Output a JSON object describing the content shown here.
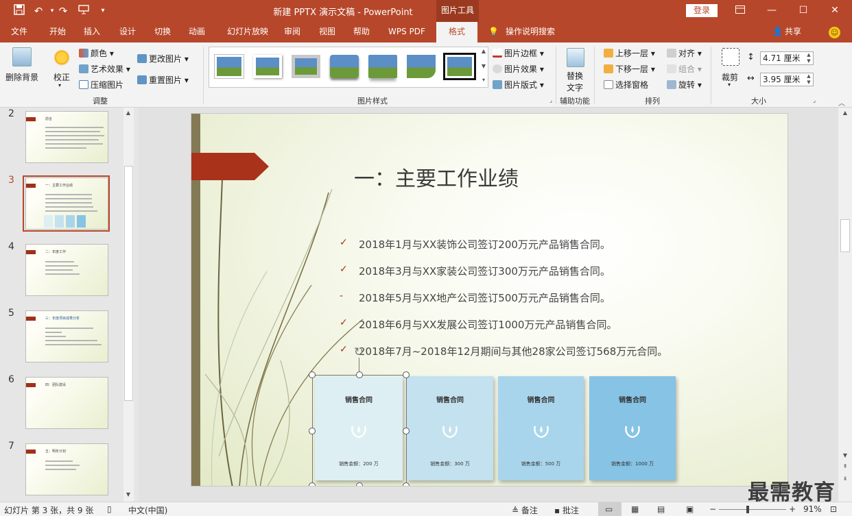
{
  "titlebar": {
    "title": "新建 PPTX 演示文稿  -  PowerPoint",
    "tool_tab": "图片工具",
    "login": "登录",
    "qat_icons": [
      "save-icon",
      "undo-icon",
      "redo-icon",
      "present-icon",
      "customize-icon"
    ]
  },
  "tabs": [
    {
      "label": "文件"
    },
    {
      "label": "开始"
    },
    {
      "label": "插入"
    },
    {
      "label": "设计"
    },
    {
      "label": "切换"
    },
    {
      "label": "动画"
    },
    {
      "label": "幻灯片放映"
    },
    {
      "label": "审阅"
    },
    {
      "label": "视图"
    },
    {
      "label": "帮助"
    },
    {
      "label": "WPS PDF"
    },
    {
      "label": "格式"
    }
  ],
  "tell_me": "操作说明搜索",
  "share": "共享",
  "ribbon": {
    "adjust": {
      "remove_bg": "删除背景",
      "correct": "校正",
      "color": "颜色",
      "artistic": "艺术效果",
      "compress": "压缩图片",
      "change": "更改图片",
      "reset": "重置图片",
      "group_label": "调整"
    },
    "styles": {
      "border": "图片边框",
      "effects": "图片效果",
      "layout": "图片版式",
      "group_label": "图片样式"
    },
    "accessibility": {
      "alt_text_1": "替换",
      "alt_text_2": "文字",
      "group_label": "辅助功能"
    },
    "arrange": {
      "bring_forward": "上移一层",
      "send_backward": "下移一层",
      "selection_pane": "选择窗格",
      "align": "对齐",
      "group": "组合",
      "rotate": "旋转",
      "group_label": "排列"
    },
    "size": {
      "crop": "裁剪",
      "height": "4.71 厘米",
      "width": "3.95 厘米",
      "group_label": "大小"
    }
  },
  "thumbnails": [
    {
      "num": "2",
      "title": "前言"
    },
    {
      "num": "3",
      "title": "一：主要工作业绩"
    },
    {
      "num": "4",
      "title": "二：年度工作"
    },
    {
      "num": "5",
      "title": "三：年度项目成果分析"
    },
    {
      "num": "6",
      "title": "四：团队建设"
    },
    {
      "num": "7",
      "title": "五：明年计划"
    }
  ],
  "slide": {
    "title": "一：主要工作业绩",
    "bullets": [
      {
        "mark": "✓",
        "text": "2018年1月与XX装饰公司签订200万元产品销售合同。"
      },
      {
        "mark": "✓",
        "text": "2018年3月与XX家装公司签订300万元产品销售合同。"
      },
      {
        "mark": "-",
        "text": "2018年5月与XX地产公司签订500万元产品销售合同。"
      },
      {
        "mark": "✓",
        "text": "2018年6月与XX发展公司签订1000万元产品销售合同。"
      },
      {
        "mark": "✓",
        "text": "2018年7月~2018年12月期间与其他28家公司签订568万元合同。"
      }
    ],
    "cards": [
      {
        "title": "销售合同",
        "amount": "销售金额：200 万",
        "color": "#deeff3"
      },
      {
        "title": "销售合同",
        "amount": "销售金额：300 万",
        "color": "#c3e1ee"
      },
      {
        "title": "销售合同",
        "amount": "销售金额：500 万",
        "color": "#a9d5ec"
      },
      {
        "title": "销售合同",
        "amount": "销售金额：1000 万",
        "color": "#86c3e4"
      }
    ]
  },
  "watermark": "最需教育",
  "status": {
    "slide_info": "幻灯片 第 3 张，共 9 张",
    "language": "中文(中国)",
    "notes": "备注",
    "comments": "批注",
    "zoom": "91%"
  },
  "colors": {
    "accent": "#b7472a",
    "flag": "#a9331a"
  }
}
